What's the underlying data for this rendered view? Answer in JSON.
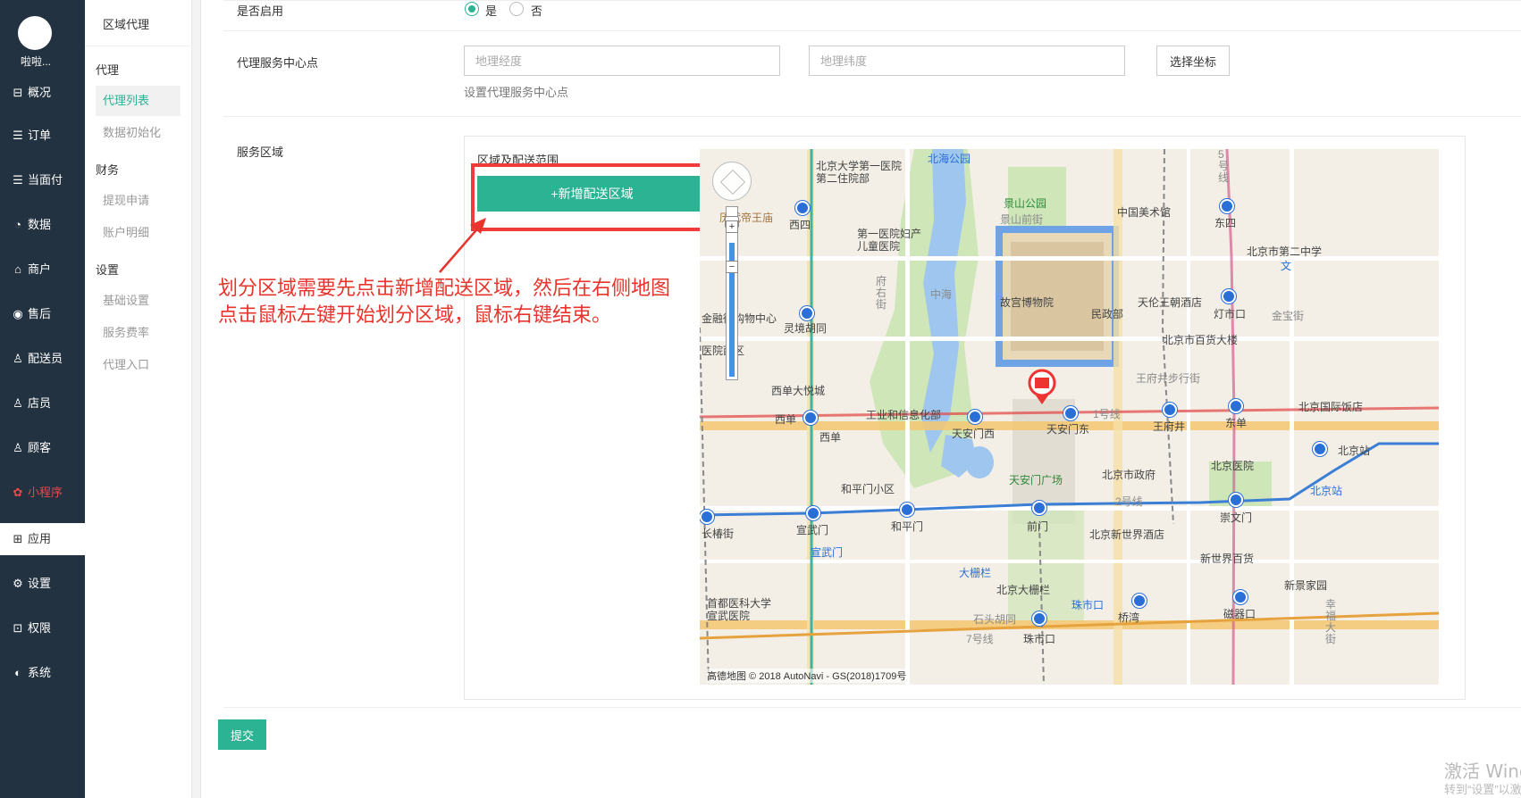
{
  "user": {
    "name": "啦啦..."
  },
  "nav": [
    {
      "icon": "⊟",
      "label": "概况"
    },
    {
      "icon": "☰",
      "label": "订单"
    },
    {
      "icon": "☰",
      "label": "当面付"
    },
    {
      "icon": "◔",
      "label": "数据"
    },
    {
      "icon": "⌂",
      "label": "商户"
    },
    {
      "icon": "◉",
      "label": "售后"
    },
    {
      "icon": "♙",
      "label": "配送员"
    },
    {
      "icon": "♙",
      "label": "店员"
    },
    {
      "icon": "♙",
      "label": "顾客"
    },
    {
      "icon": "✿",
      "label": "小程序"
    },
    {
      "icon": "⊞",
      "label": "应用"
    },
    {
      "icon": "⚙",
      "label": "设置"
    },
    {
      "icon": "⊡",
      "label": "权限"
    },
    {
      "icon": "◐",
      "label": "系统"
    }
  ],
  "subnav": {
    "title": "区域代理",
    "groups": [
      {
        "label": "代理",
        "items": [
          "代理列表",
          "数据初始化"
        ]
      },
      {
        "label": "财务",
        "items": [
          "提现申请",
          "账户明细"
        ]
      },
      {
        "label": "设置",
        "items": [
          "基础设置",
          "服务费率",
          "代理入口"
        ]
      }
    ]
  },
  "form": {
    "enabled_label": "是否启用",
    "yes": "是",
    "no": "否",
    "center_label": "代理服务中心点",
    "lng_placeholder": "地理经度",
    "lat_placeholder": "地理纬度",
    "choose_coord": "选择坐标",
    "center_help": "设置代理服务中心点",
    "area_label": "服务区域",
    "area_title": "区域及配送范围",
    "add_area": "+新增配送区域",
    "submit": "提交"
  },
  "annotation": {
    "line1": "划分区域需要先点击新增配送区域，然后在右侧地图",
    "line2": "点击鼠标左键开始划分区域，鼠标右键结束。"
  },
  "map": {
    "copyright": "高德地图 © 2018 AutoNavi - GS(2018)1709号",
    "labels": {
      "beihai": "北海公园",
      "jingshan": "景山公园",
      "jingshanqian": "景山前街",
      "pku_hospital": "北京大学第一医院第二住院部",
      "lidai": "历代帝王庙",
      "xisi": "西四",
      "first_hospital": "第一医院妇产儿童医院",
      "art_museum": "中国美术馆",
      "dongsi": "东四",
      "no2_school": "北京市第二中学",
      "wen": "文",
      "zhonghai": "中海",
      "palace": "故宫博物院",
      "minzheng": "民政部",
      "tianlun": "天伦王朝酒店",
      "dengshikou": "灯市口",
      "jinbao": "金宝街",
      "fuyou": "府右街",
      "jinrong": "金融街购物中心",
      "lingjing": "灵境胡同",
      "hospital_west": "医院西区",
      "joy_city": "西单大悦城",
      "dept_store": "北京市百货大楼",
      "wangfujing_walk": "王府井步行街",
      "miit": "工业和信息化部",
      "xidan": "西单",
      "xidan2": "西单",
      "tam_west": "天安门西",
      "tam_east": "天安门东",
      "line1": "1号线",
      "wangfujing": "王府井",
      "dongdan": "东单",
      "intl_hotel": "北京国际饭店",
      "tam_square": "天安门广场",
      "gov": "北京市政府",
      "pumc": "北京医院",
      "bj_station_metro": "北京站",
      "bj_station": "北京站",
      "hepingmen_xq": "和平门小区",
      "line2": "2号线",
      "xuanwumen": "宣武门",
      "xuanwumen2": "宣武门",
      "hepingmen": "和平门",
      "qianmen": "前门",
      "chongwenmen": "崇文门",
      "changchun": "长椿街",
      "xinshijie_hotel": "北京新世界酒店",
      "xinshijie": "新世界百货",
      "dashilan": "大栅栏",
      "dashilan2": "北京大栅栏",
      "xinjing": "新景家园",
      "xuanwu_hospital": "首都医科大学宣武医院",
      "shitou": "石头胡同",
      "zhushikou": "珠市口",
      "zhushikou2": "珠市口",
      "zhushikou3": "珠市口",
      "qiaowan": "桥湾",
      "ciqikou": "磁器口",
      "xingfu": "幸福大街",
      "line7": "7号线",
      "line5": "5号线",
      "line_unk": "号线",
      "jie": "融街"
    }
  },
  "watermark": {
    "line1": "激活 Windows",
    "line2": "转到“设置”以激活 Windows。"
  },
  "colors": {
    "accent": "#2bb394",
    "nav_bg": "#233240",
    "annotation": "#e8342c"
  }
}
